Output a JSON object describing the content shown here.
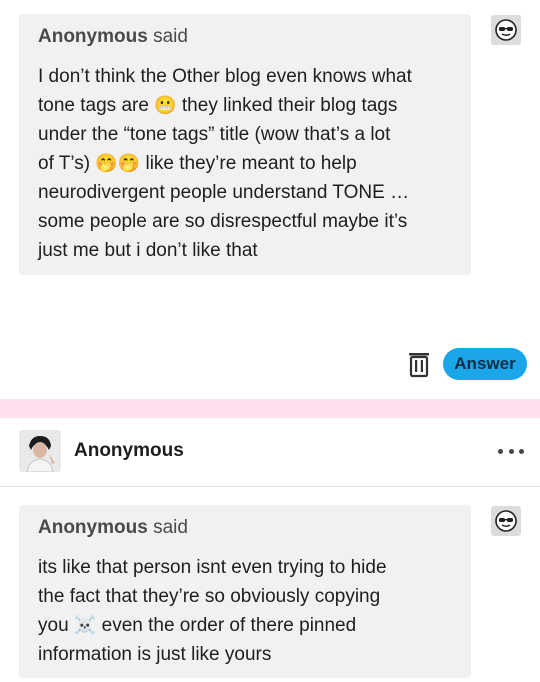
{
  "ask1": {
    "sender": "Anonymous",
    "said": "said",
    "lines": [
      [
        "I don’t think the Other blog even knows what",
        ""
      ],
      [
        "tone tags are ",
        "😬",
        " they linked their blog tags"
      ],
      [
        "under the “tone tags” title (wow that’s a lot",
        ""
      ],
      [
        "of T’s) ",
        "🤭🤭",
        " like they’re meant to help"
      ],
      [
        "neurodivergent people understand TONE …",
        ""
      ],
      [
        "some people are so disrespectful maybe it’s",
        ""
      ],
      [
        "just me but i don’t like that",
        ""
      ]
    ]
  },
  "actions": {
    "answer_label": "Answer",
    "icons": {
      "delete": "trash-icon",
      "avatar": "sunglasses-face-icon"
    }
  },
  "post": {
    "author": "Anonymous",
    "more": "more-options-icon"
  },
  "ask2": {
    "sender": "Anonymous",
    "said": "said",
    "lines": [
      [
        "its like that person isnt even trying to hide",
        ""
      ],
      [
        "the fact that they’re so obviously copying",
        ""
      ],
      [
        "you ",
        "☠️",
        " even the order of there pinned"
      ],
      [
        "information is just like yours",
        ""
      ]
    ]
  },
  "colors": {
    "accent": "#1aa6e8",
    "band": "#ffdeee",
    "bubble": "#f1f1f1"
  }
}
